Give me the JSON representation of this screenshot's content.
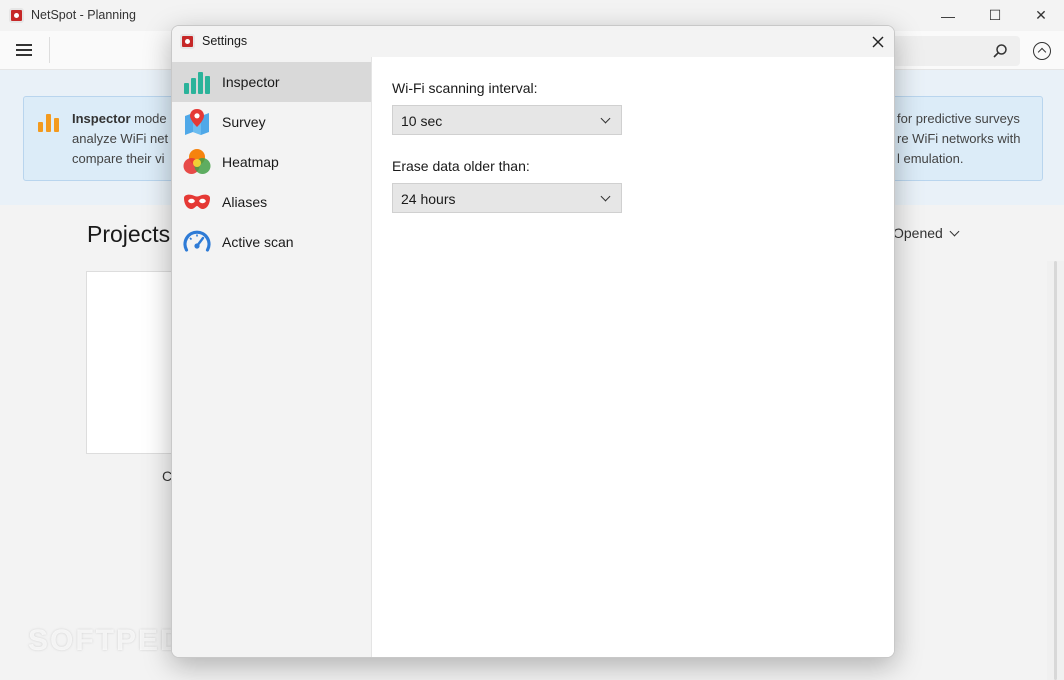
{
  "window": {
    "title": "NetSpot - Planning",
    "controls": {
      "minimize": "—",
      "maximize": "☐",
      "close": "✕"
    }
  },
  "banner": {
    "line1_bold": "Inspector",
    "line1": " mode",
    "line1_right": "for predictive surveys",
    "line2": "analyze WiFi net",
    "line2_right": "re WiFi networks with",
    "line3": "compare their vi",
    "line3_right": "l emulation."
  },
  "main": {
    "projects_title": "Projects",
    "sort_label": "Opened",
    "card_caption": "C"
  },
  "watermark": "SOFTPEDIA",
  "settings": {
    "title": "Settings",
    "close_icon": "✕",
    "nav": [
      {
        "label": "Inspector",
        "icon": "bar-chart-icon",
        "selected": true
      },
      {
        "label": "Survey",
        "icon": "map-pin-icon",
        "selected": false
      },
      {
        "label": "Heatmap",
        "icon": "heatmap-icon",
        "selected": false
      },
      {
        "label": "Aliases",
        "icon": "mask-icon",
        "selected": false
      },
      {
        "label": "Active scan",
        "icon": "speedometer-icon",
        "selected": false
      }
    ],
    "scan_interval": {
      "label": "Wi-Fi scanning interval:",
      "value": "10 sec"
    },
    "erase_data": {
      "label": "Erase data older than:",
      "value": "24 hours"
    }
  },
  "colors": {
    "accent_teal": "#2bb39a",
    "heatmap_red": "#e53935",
    "mask_red": "#e53935",
    "gauge_blue": "#2e7bd6",
    "banner_orange": "#f39a1e"
  }
}
